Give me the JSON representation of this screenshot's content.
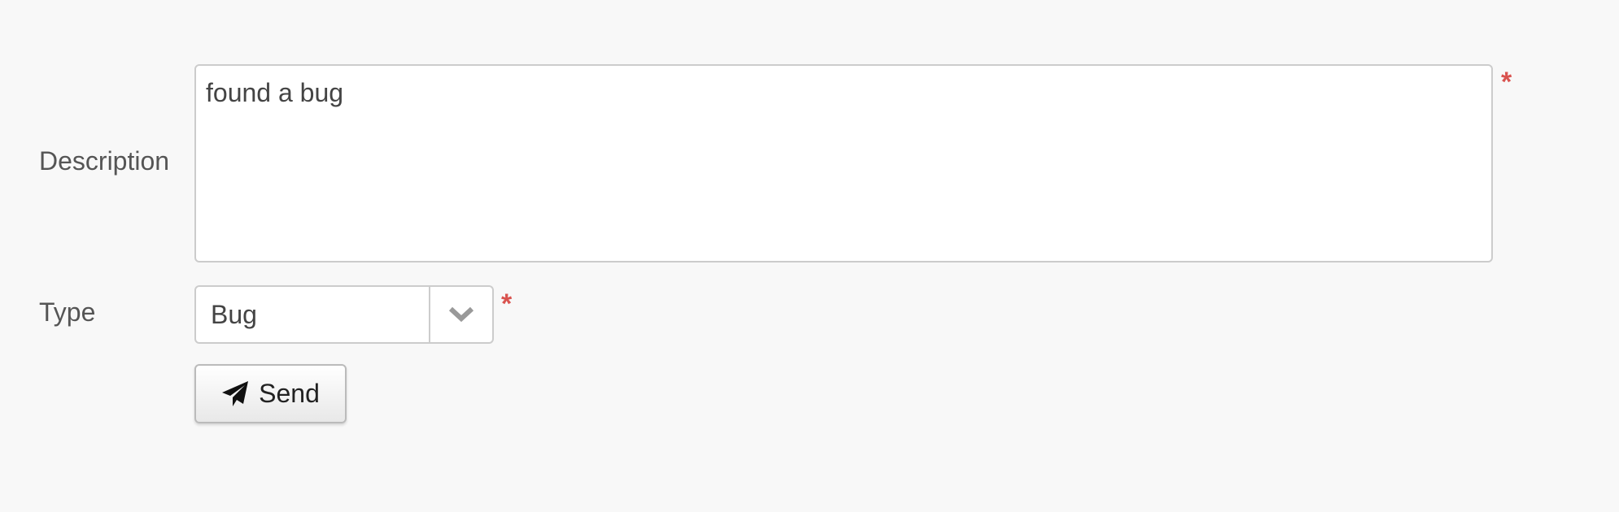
{
  "form": {
    "description": {
      "label": "Description",
      "value": "found a bug",
      "required_mark": "*"
    },
    "type": {
      "label": "Type",
      "selected": "Bug",
      "required_mark": "*"
    },
    "submit": {
      "label": "Send",
      "icon": "paper-plane-icon"
    }
  },
  "colors": {
    "required": "#d9534f",
    "background": "#f8f8f8"
  }
}
